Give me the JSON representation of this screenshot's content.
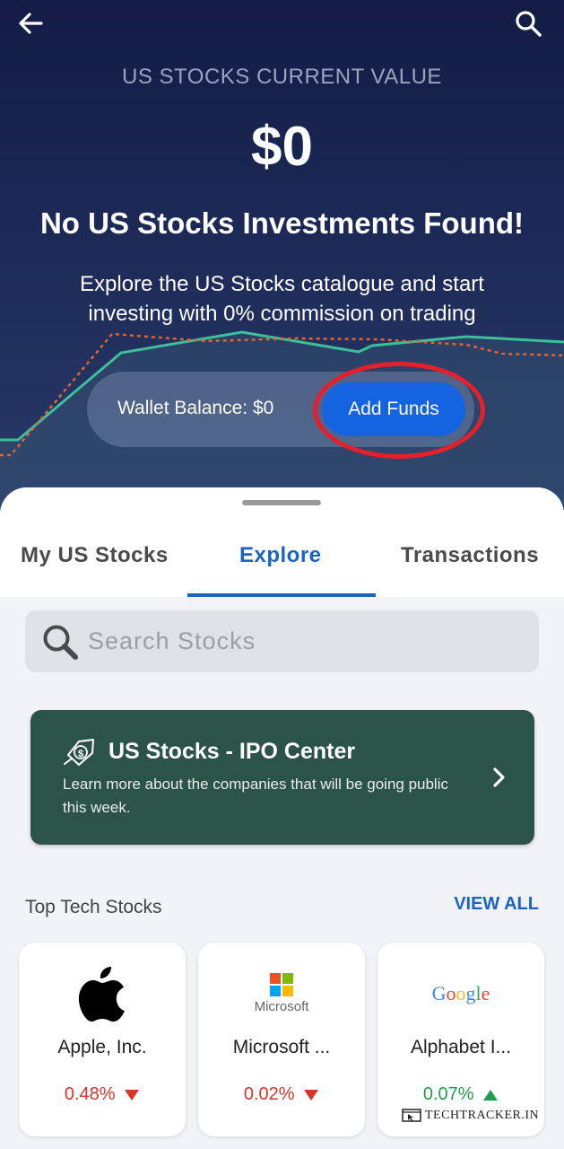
{
  "header": {
    "current_value_label": "US STOCKS CURRENT VALUE",
    "current_value": "$0",
    "no_investments": "No US Stocks Investments Found!",
    "description": "Explore the US Stocks catalogue and start investing with 0% commission on trading"
  },
  "wallet": {
    "balance_label": "Wallet Balance: $0",
    "add_funds_label": "Add Funds"
  },
  "tabs": [
    {
      "label": "My US Stocks",
      "active": false
    },
    {
      "label": "Explore",
      "active": true
    },
    {
      "label": "Transactions",
      "active": false
    }
  ],
  "search": {
    "placeholder": "Search Stocks"
  },
  "ipo": {
    "title": "US Stocks - IPO Center",
    "description": "Learn more about the companies that will be going public this week."
  },
  "top_tech": {
    "title": "Top Tech Stocks",
    "view_all": "VIEW ALL",
    "stocks": [
      {
        "name": "Apple, Inc.",
        "change": "0.48%",
        "direction": "down"
      },
      {
        "name": "Microsoft ...",
        "logo_text": "Microsoft",
        "change": "0.02%",
        "direction": "down"
      },
      {
        "name": "Alphabet I...",
        "logo_text": "Google",
        "change": "0.07%",
        "direction": "up"
      }
    ]
  },
  "watermark": "TECHTRACKER.IN",
  "colors": {
    "header_bg": "#1d2a58",
    "accent_blue": "#1463e0",
    "ipo_green": "#2c5347",
    "negative": "#d8352a",
    "positive": "#1f9e4c",
    "highlight_ring": "#e5202a"
  }
}
